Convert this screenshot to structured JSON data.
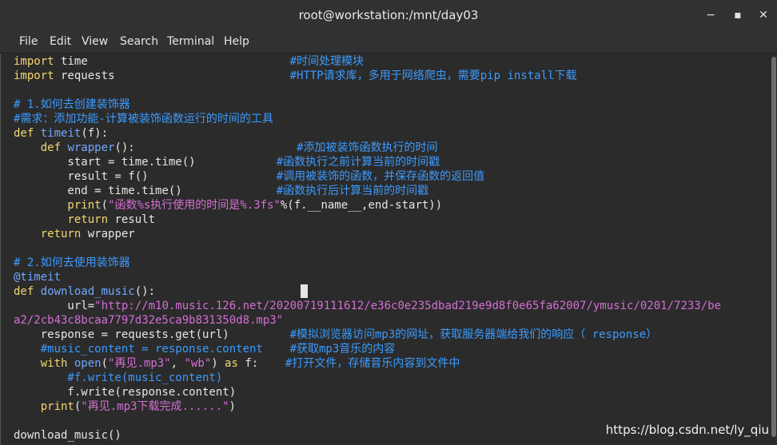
{
  "window": {
    "title": "root@workstation:/mnt/day03",
    "controls": {
      "minimize": "−",
      "maximize": "▪",
      "close": "✕"
    }
  },
  "menubar": {
    "items": [
      "File",
      "Edit",
      "View",
      "Search",
      "Terminal",
      "Help"
    ]
  },
  "code": {
    "l1": "import",
    "l1b": " time                              ",
    "l1c": "#时间处理模块",
    "l2": "import",
    "l2b": " requests                          ",
    "l2c": "#HTTP请求库，多用于网络爬虫，需要pip install下载",
    "l3": "# 1.如何去创建装饰器",
    "l4": "#需求：添加功能-计算被装饰函数运行的时间的工具",
    "l5a": "def",
    "l5b": " timeit",
    "l5c": "(f):",
    "l6a": "    def",
    "l6b": " wrapper",
    "l6c": "():                        ",
    "l6d": "#添加被装饰函数执行的时间",
    "l7a": "        start = time.time()            ",
    "l7b": "#函数执行之前计算当前的时间戳",
    "l8a": "        result = f()                   ",
    "l8b": "#调用被装饰的函数，并保存函数的返回值",
    "l9a": "        end = time.time()              ",
    "l9b": "#函数执行后计算当前的时间戳",
    "l10a": "        print",
    "l10b": "(",
    "l10c": "\"函数%s执行使用的时间是%.3fs\"",
    "l10d": "%(f.__name__,end-start))",
    "l11a": "        return",
    "l11b": " result",
    "l12a": "    return",
    "l12b": " wrapper",
    "l13": "# 2.如何去使用装饰器",
    "l14": "@timeit",
    "l15a": "def",
    "l15b": " download_music",
    "l15c": "():",
    "l16a": "        url=",
    "l16b": "\"http://m10.music.126.net/20200719111612/e36c0e235dbad219e9d8f0e65fa62007/ymusic/0201/7233/be",
    "l17": "a2/2cb43c8bcaa7797d32e5ca9b831350d8.mp3\"",
    "l18a": "    response = requests.get(url)         ",
    "l18b": "#模拟浏览器访问mp3的网址，获取服务器端给我们的响应（ response）",
    "l19a": "    #music_content = response.content    ",
    "l19b": "#获取mp3音乐的内容",
    "l20a": "    with",
    "l20b": " open",
    "l20c": "(",
    "l20d": "\"再见.mp3\"",
    "l20e": ", ",
    "l20f": "\"wb\"",
    "l20g": ") ",
    "l20h": "as",
    "l20i": " f:    ",
    "l20j": "#打开文件，存储音乐内容到文件中",
    "l21": "        #f.write(music_content)",
    "l22": "        f.write(response.content)",
    "l23a": "    print",
    "l23b": "(",
    "l23c": "\"再见.mp3下载完成......\"",
    "l23d": ")",
    "l24": "download_music()"
  },
  "watermark": "https://blog.csdn.net/ly_qiu"
}
